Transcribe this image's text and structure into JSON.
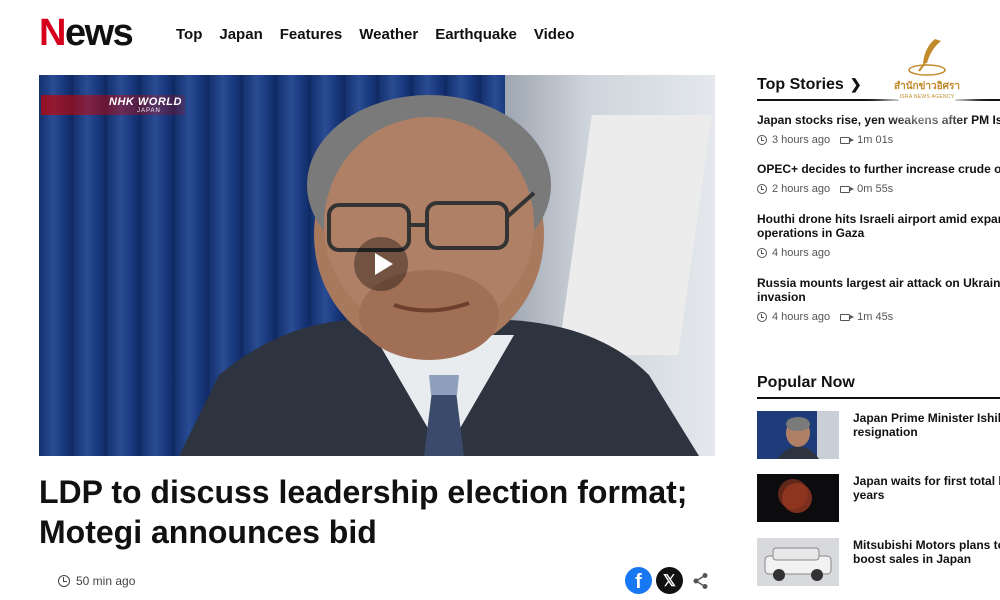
{
  "header": {
    "logo_first": "N",
    "logo_rest": "ews",
    "nav": [
      "Top",
      "Japan",
      "Features",
      "Weather",
      "Earthquake",
      "Video"
    ]
  },
  "hero": {
    "watermark": "NHK WORLD",
    "watermark_sub": "JAPAN",
    "headline": "LDP to discuss leadership election format; Motegi announces bid",
    "time": "50 min ago"
  },
  "share": {
    "facebook": "f",
    "x": "𝕏"
  },
  "top_stories": {
    "title": "Top Stories",
    "items": [
      {
        "title": "Japan stocks rise, yen weakens after PM Ishiba",
        "time": "3 hours ago",
        "duration": "1m 01s"
      },
      {
        "title": "OPEC+ decides to further increase crude oil out",
        "time": "2 hours ago",
        "duration": "0m 55s"
      },
      {
        "title": "Houthi drone hits Israeli airport amid expansion",
        "title2": "operations in Gaza",
        "time": "4 hours ago",
        "duration": ""
      },
      {
        "title": "Russia mounts largest air attack on Ukraine sin",
        "title2": "invasion",
        "time": "4 hours ago",
        "duration": "1m 45s"
      }
    ]
  },
  "popular": {
    "title": "Popular Now",
    "items": [
      {
        "title": "Japan Prime Minister Ishiba",
        "title2": "resignation"
      },
      {
        "title": "Japan waits for first total lu",
        "title2": "years"
      },
      {
        "title": "Mitsubishi Motors plans to re",
        "title2": "boost sales in Japan"
      }
    ]
  },
  "badge": {
    "thai": "สำนักข่าวอิศรา",
    "english": "ISRA NEWS AGENCY"
  },
  "colors": {
    "brand_red": "#d6001c",
    "facebook": "#1877f2"
  }
}
